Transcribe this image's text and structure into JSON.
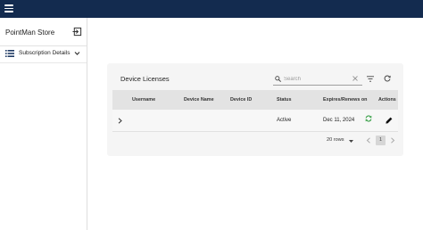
{
  "app": {
    "store_name": "PointMan Store"
  },
  "sidebar": {
    "items": [
      {
        "label": "Subscription Details",
        "icon": "list-icon",
        "expand_icon": "chevron-down-icon"
      }
    ]
  },
  "licenses": {
    "title": "Device Licenses",
    "search": {
      "placeholder": "Search",
      "value": ""
    },
    "columns": [
      "Username",
      "Device Name",
      "Device ID",
      "Status",
      "Expires/Renews on",
      "Actions"
    ],
    "rows": [
      {
        "username": "",
        "device_name": "",
        "device_id": "",
        "status": "Active",
        "expires": "Dec 11, 2024",
        "renew_icon": "auto-renew-icon",
        "action_icon": "edit-icon"
      }
    ],
    "pagination": {
      "rows_per_page": "20 rows",
      "current_page": "1"
    }
  },
  "colors": {
    "topbar": "#132b4f",
    "renew_green": "#3fa34d",
    "card_bg": "#f5f5f5",
    "header_bg": "#e3e3e3"
  }
}
